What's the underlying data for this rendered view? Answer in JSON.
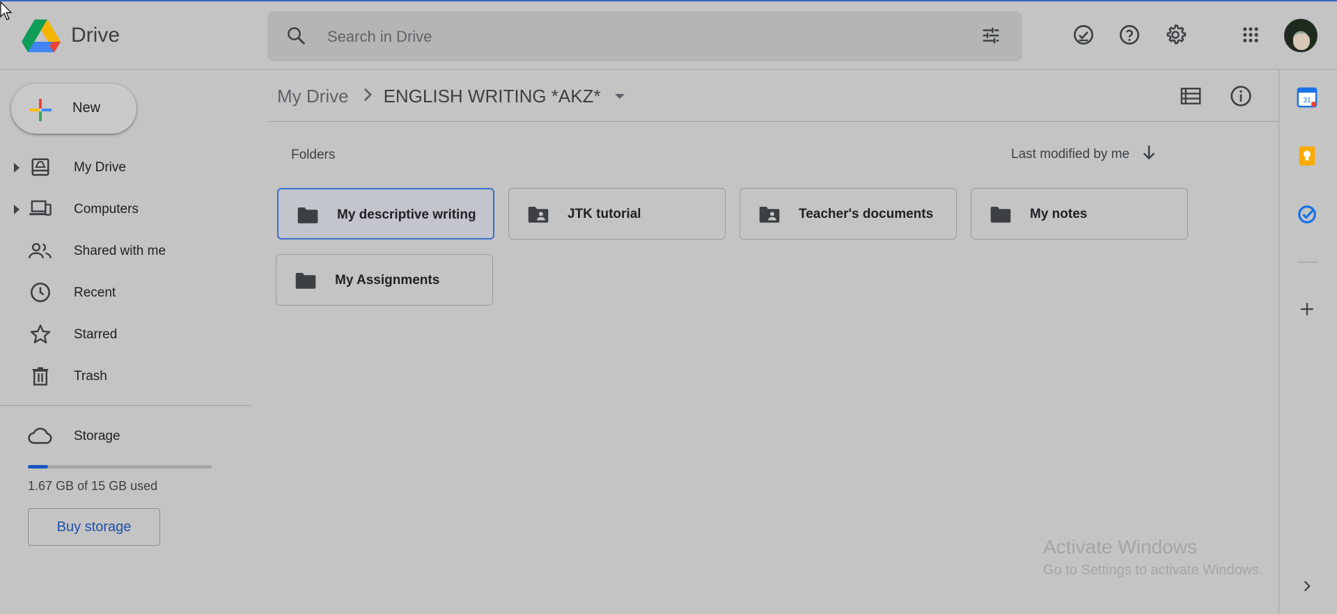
{
  "app": {
    "name": "Drive"
  },
  "search": {
    "placeholder": "Search in Drive"
  },
  "header_icons": [
    "offline-ready-icon",
    "help-icon",
    "settings-icon",
    "apps-grid-icon"
  ],
  "sidebar": {
    "new_label": "New",
    "items": [
      {
        "label": "My Drive",
        "icon": "my-drive-icon",
        "expandable": true
      },
      {
        "label": "Computers",
        "icon": "computers-icon",
        "expandable": true
      },
      {
        "label": "Shared with me",
        "icon": "shared-icon",
        "expandable": false
      },
      {
        "label": "Recent",
        "icon": "clock-icon",
        "expandable": false
      },
      {
        "label": "Starred",
        "icon": "star-icon",
        "expandable": false
      },
      {
        "label": "Trash",
        "icon": "trash-icon",
        "expandable": false
      }
    ],
    "storage": {
      "label": "Storage",
      "used_text": "1.67 GB of 15 GB used",
      "used_fraction": 0.111,
      "buy_label": "Buy storage"
    }
  },
  "breadcrumb": {
    "root": "My Drive",
    "current": "ENGLISH WRITING *AKZ*"
  },
  "folders_section": {
    "title": "Folders",
    "sort_label": "Last modified by me",
    "folders": [
      {
        "name": "My descriptive writing",
        "shared": false,
        "selected": true
      },
      {
        "name": "JTK tutorial",
        "shared": true,
        "selected": false
      },
      {
        "name": "Teacher's documents",
        "shared": true,
        "selected": false
      },
      {
        "name": "My notes",
        "shared": false,
        "selected": false
      },
      {
        "name": "My Assignments",
        "shared": false,
        "selected": false
      }
    ]
  },
  "right_panel": {
    "calendar_day": "31"
  },
  "watermark": {
    "title": "Activate Windows",
    "subtitle": "Go to Settings to activate Windows."
  },
  "colors": {
    "accent": "#1a56c4",
    "background": "#c4c4c4"
  }
}
